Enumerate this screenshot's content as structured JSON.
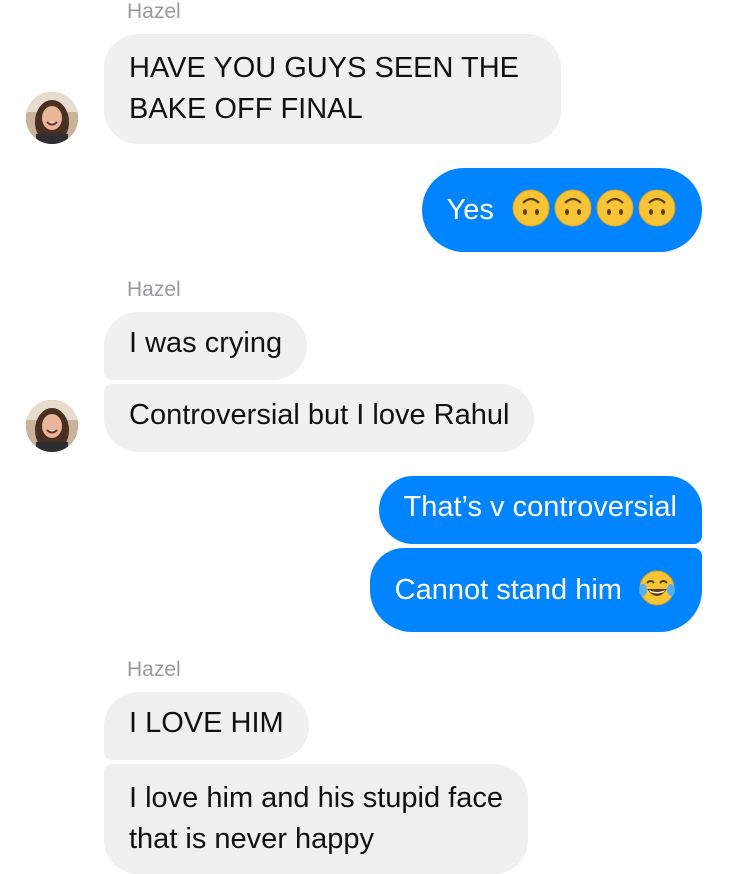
{
  "conversation": {
    "groups": [
      {
        "sender": "Hazel",
        "messages": [
          "HAVE YOU GUYS SEEN THE\nBAKE OFF FINAL"
        ]
      },
      {
        "outgoing": [
          "Yes"
        ]
      },
      {
        "sender": "Hazel",
        "messages": [
          "I was crying",
          "Controversial but I love Rahul"
        ]
      },
      {
        "outgoing": [
          "That’s v controversial",
          "Cannot stand him"
        ]
      },
      {
        "sender": "Hazel",
        "messages": [
          "I LOVE HIM",
          "I love him and his stupid face\nthat is never happy"
        ]
      }
    ]
  },
  "emojis": {
    "upside_down_face": "upside-down-face-icon",
    "tears_of_joy": "face-with-tears-of-joy-icon"
  },
  "colors": {
    "outgoing_bubble": "#0084ff",
    "incoming_bubble": "#f0f0f0",
    "sender_label": "#9a9a9f"
  }
}
